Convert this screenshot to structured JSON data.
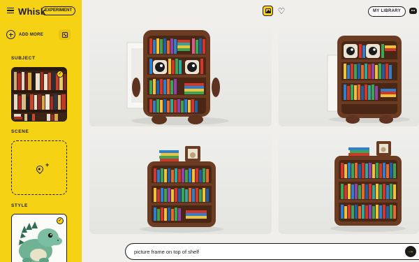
{
  "app": {
    "title": "Whisk",
    "badge": "EXPERIMENT",
    "menu_icon": "menu-icon"
  },
  "sidebar": {
    "add_more_label": "ADD MORE",
    "dice_icon": "dice-icon",
    "sections": {
      "subject": "SUBJECT",
      "scene": "SCENE",
      "style": "STYLE"
    },
    "subject_selected": true,
    "style_selected": true,
    "scene_empty": true
  },
  "header": {
    "my_library_label": "MY LIBRARY",
    "icons": [
      "image-icon",
      "heart-icon",
      "discord-icon"
    ]
  },
  "gallery": {
    "tiles": [
      {
        "name": "result-1",
        "subject": "plush bookshelf with eyes"
      },
      {
        "name": "result-2",
        "subject": "plush bookshelf with eyes"
      },
      {
        "name": "result-3",
        "subject": "plush bookshelf with picture frame"
      },
      {
        "name": "result-4",
        "subject": "plush bookshelf with picture frame"
      }
    ]
  },
  "prompt": {
    "value": "picture frame on top of shelf",
    "send_icon": "arrow-right-icon"
  },
  "colors": {
    "accent": "#f6d215",
    "ink": "#1b1b1b",
    "canvas": "#f0efec",
    "plush_brown": "#6b3b22"
  }
}
